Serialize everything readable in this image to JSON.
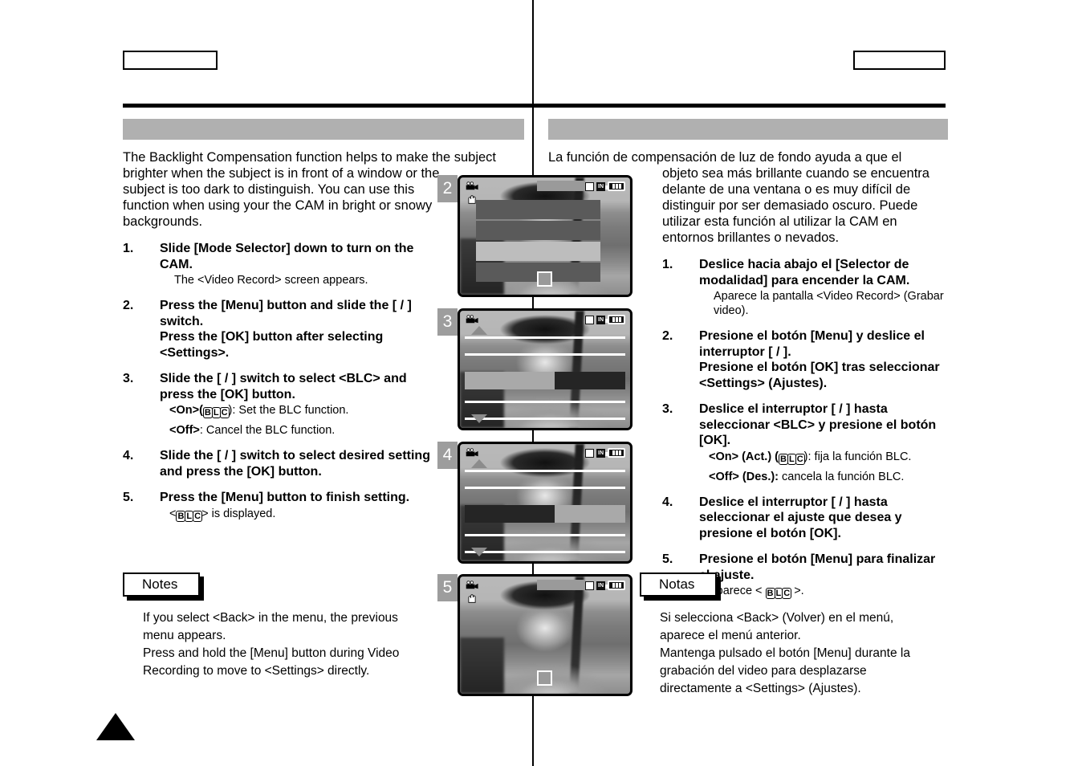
{
  "page": {
    "header_left_box": "",
    "header_right_box": "",
    "title_bar_left": "",
    "title_bar_right": "",
    "page_arrow": "page-down-triangle"
  },
  "english": {
    "intro_line1": "The Backlight Compensation function helps to make the subject",
    "intro_rest": "brighter when the subject is in front of a window or the subject is too dark to distinguish. You can use this function when using your the CAM in bright or snowy backgrounds.",
    "steps": [
      {
        "num": "1.",
        "title": "Slide [Mode Selector] down to turn on the CAM.",
        "sub": "The <Video Record> screen appears."
      },
      {
        "num": "2.",
        "title": "Press the [Menu] button and slide the [    /    ] switch.",
        "title2": "Press the [OK] button after selecting <Settings>.",
        "sub": ""
      },
      {
        "num": "3.",
        "title": "Slide the [    /    ] switch to select <BLC> and press the [OK] button.",
        "sub_on_label": "<On>(",
        "sub_on_tail": "): Set the BLC function.",
        "sub_off_label": "<Off>",
        "sub_off_tail": ": Cancel the BLC function."
      },
      {
        "num": "4.",
        "title": "Slide the [    /    ] switch to select desired setting and press the [OK] button.",
        "sub": ""
      },
      {
        "num": "5.",
        "title": "Press the [Menu] button to finish setting.",
        "sub_pre": "<",
        "sub_post": "> is displayed."
      }
    ],
    "notes": {
      "label": "Notes",
      "line1": "If you select <Back> in the menu, the previous",
      "line2": "menu appears.",
      "line3": "Press and hold the [Menu] button during Video",
      "line4": "Recording to move to <Settings> directly."
    }
  },
  "spanish": {
    "intro_line1": "La función de compensación de luz de fondo ayuda a que el",
    "intro_rest": "objeto sea más brillante cuando se encuentra delante de una ventana o es muy difícil de distinguir por ser demasiado oscuro. Puede utilizar esta función al utilizar la CAM en entornos brillantes o nevados.",
    "steps": [
      {
        "num": "1.",
        "title": "Deslice hacia abajo el [Selector de modalidad] para encender la CAM.",
        "sub": "Aparece la pantalla <Video Record> (Grabar video)."
      },
      {
        "num": "2.",
        "title": "Presione el botón [Menu] y deslice el interruptor [    /    ].",
        "title2": "Presione el botón [OK] tras seleccionar <Settings> (Ajustes).",
        "sub": ""
      },
      {
        "num": "3.",
        "title": "Deslice el interruptor [    /    ] hasta seleccionar <BLC> y presione el botón [OK].",
        "sub_on_label": "<On> (Act.) (",
        "sub_on_tail": "): fija la función BLC.",
        "sub_off_label": "<Off> (Des.):",
        "sub_off_tail": " cancela la función BLC."
      },
      {
        "num": "4.",
        "title": "Deslice el interruptor [    /    ] hasta seleccionar el ajuste que desea y presione el botón [OK].",
        "sub": ""
      },
      {
        "num": "5.",
        "title": "Presione el botón [Menu] para finalizar el ajuste.",
        "sub_pre": "Aparece < ",
        "sub_post": " >."
      }
    ],
    "notes": {
      "label": "Notas",
      "line1": "Si selecciona <Back> (Volver) en el menú,",
      "line2": "aparece el menú anterior.",
      "line3": "Mantenga pulsado el botón [Menu] durante la",
      "line4": "grabación del video para desplazarse",
      "line5": "directamente a <Settings> (Ajustes)."
    }
  },
  "screenshots": [
    {
      "number": "2",
      "osd": {
        "card": "memory-card",
        "in": "IN",
        "battery": "battery-full"
      },
      "overlay": "menu-panel",
      "menu_rows": [
        "",
        "",
        "",
        ""
      ],
      "selected_row_index": 2
    },
    {
      "number": "3",
      "osd": {
        "card": "memory-card",
        "in": "IN",
        "battery": "battery-full"
      },
      "overlay": "list-highlight-light"
    },
    {
      "number": "4",
      "osd": {
        "card": "memory-card",
        "in": "IN",
        "battery": "battery-full"
      },
      "overlay": "list-highlight-dark"
    },
    {
      "number": "5",
      "osd": {
        "card": "memory-card",
        "in": "IN",
        "battery": "battery-full"
      },
      "overlay": "none"
    }
  ],
  "icons": {
    "blc": [
      "B",
      "L",
      "C"
    ],
    "camcorder": "camcorder-icon",
    "hand": "anti-shake-hand-icon"
  },
  "colors": {
    "title_bar": "#b0b0b0",
    "shot_number_bg": "#9d9d9d",
    "menu_row": "#5a5a5a",
    "menu_row_selected": "#bdbdbd",
    "highlight_dark": "#252525",
    "highlight_light": "#a9a9a9"
  }
}
